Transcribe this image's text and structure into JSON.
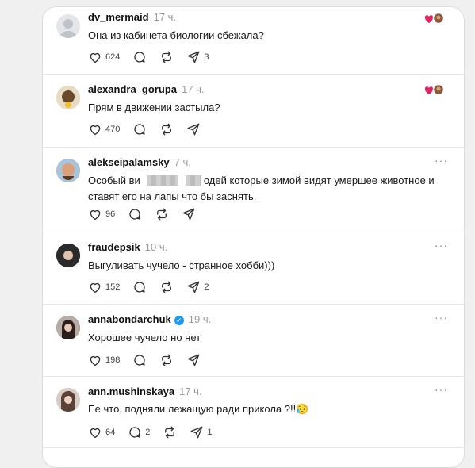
{
  "comments": [
    {
      "username": "dv_mermaid",
      "time": "17 ч.",
      "text": "Она из кабинета биологии сбежала?",
      "likes": "624",
      "replies": "",
      "reposts": "",
      "shares": "3",
      "more": "···"
    },
    {
      "username": "alexandra_gorupa",
      "time": "17 ч.",
      "text": "Прям в движении застыла?",
      "likes": "470",
      "replies": "",
      "reposts": "",
      "shares": "",
      "more": "···"
    },
    {
      "username": "alekseipalamsky",
      "time": "7 ч.",
      "text_a": "Особый ви",
      "text_b": "одей которые зимой видят умершее животное и ставят его на лапы что бы заснять.",
      "likes": "96",
      "replies": "",
      "reposts": "",
      "shares": "",
      "more": "···"
    },
    {
      "username": "fraudepsik",
      "time": "10 ч.",
      "text": "Выгуливать чучело - странное хобби)))",
      "likes": "152",
      "replies": "",
      "reposts": "",
      "shares": "2",
      "more": "···"
    },
    {
      "username": "annabondarchuk",
      "time": "19 ч.",
      "text": "Хорошее чучело но нет",
      "likes": "198",
      "replies": "",
      "reposts": "",
      "shares": "",
      "more": "···"
    },
    {
      "username": "ann.mushinskaya",
      "time": "17 ч.",
      "text": "Ее что, подняли лежащую ради прикола ?!!😥",
      "likes": "64",
      "replies": "2",
      "reposts": "",
      "shares": "1",
      "more": "···"
    }
  ],
  "colors": {
    "verified": "#1d9bf0",
    "heart_red": "#e0245e"
  },
  "icons": [
    "heart-icon",
    "comment-icon",
    "repost-icon",
    "share-icon",
    "verified-icon"
  ]
}
